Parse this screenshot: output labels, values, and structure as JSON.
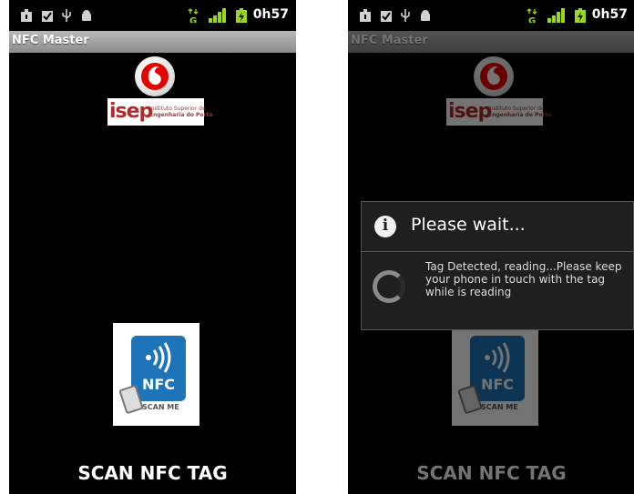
{
  "status_bar": {
    "time": "0h57",
    "network": "G"
  },
  "app": {
    "title": "NFC Master"
  },
  "logos": {
    "isep_word": "isep",
    "isep_line1": "Instituto Superior de",
    "isep_line2": "Engenharia do Porto"
  },
  "nfc_tile": {
    "nfc_label": "NFC",
    "scan_me": "SCAN ME"
  },
  "scan_button": {
    "label": "SCAN NFC TAG"
  },
  "dialog": {
    "title": "Please wait...",
    "message": "Tag Detected, reading...Please keep your phone in touch with the tag while is reading"
  },
  "colors": {
    "vodafone_red": "#e60000",
    "nfc_blue": "#1e74b8",
    "battery_green": "#9bd81c"
  }
}
